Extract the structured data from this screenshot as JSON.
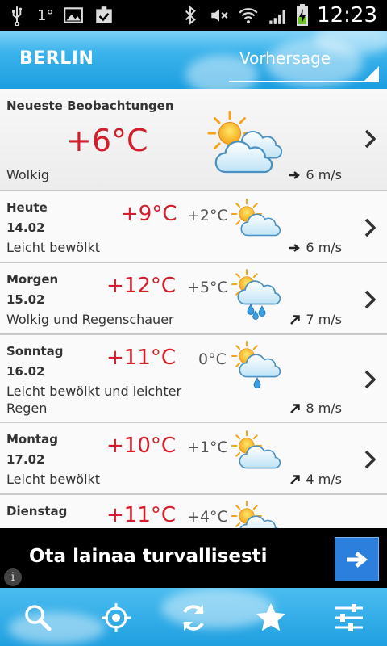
{
  "status_bar": {
    "temperature": "1°",
    "time": "12:23"
  },
  "header": {
    "city": "BERLIN",
    "tab_label": "Vorhersage"
  },
  "observation": {
    "title": "Neueste Beobachtungen",
    "temperature": "+6°C",
    "condition": "Wolkig",
    "wind": "6 m/s",
    "icon": "partly-cloudy-icon"
  },
  "forecast": [
    {
      "day": "Heute",
      "date": "14.02",
      "max": "+9°C",
      "min": "+2°C",
      "condition": "Leicht bewölkt",
      "condition_line2": "",
      "wind": "6 m/s",
      "wind_direction": "east",
      "icon": "sun-cloud-icon"
    },
    {
      "day": "Morgen",
      "date": "15.02",
      "max": "+12°C",
      "min": "+5°C",
      "condition": "Wolkig und Regenschauer",
      "condition_line2": "",
      "wind": "7 m/s",
      "wind_direction": "north-east",
      "icon": "sun-cloud-rain-icon"
    },
    {
      "day": "Sonntag",
      "date": "16.02",
      "max": "+11°C",
      "min": "0°C",
      "condition": "Leicht bewölkt und leichter",
      "condition_line2": "Regen",
      "wind": "8 m/s",
      "wind_direction": "north-east",
      "icon": "sun-cloud-light-rain-icon"
    },
    {
      "day": "Montag",
      "date": "17.02",
      "max": "+10°C",
      "min": "+1°C",
      "condition": "Leicht bewölkt",
      "condition_line2": "",
      "wind": "4 m/s",
      "wind_direction": "north-east",
      "icon": "sun-cloud-icon"
    },
    {
      "day": "Dienstag",
      "date": "",
      "max": "+11°C",
      "min": "+4°C",
      "condition": "",
      "condition_line2": "",
      "wind": "",
      "wind_direction": "",
      "icon": "sun-cloud-icon"
    }
  ],
  "ad": {
    "text": "Ota lainaa turvallisesti",
    "info_glyph": "i"
  },
  "toolbar": {
    "items": [
      "search-icon",
      "locate-icon",
      "refresh-icon",
      "favorite-star-icon",
      "settings-sliders-icon"
    ]
  },
  "colors": {
    "temp_max": "#d51d2c",
    "header_blue": "#1c9ee0",
    "ad_button": "#2d7fdd"
  }
}
